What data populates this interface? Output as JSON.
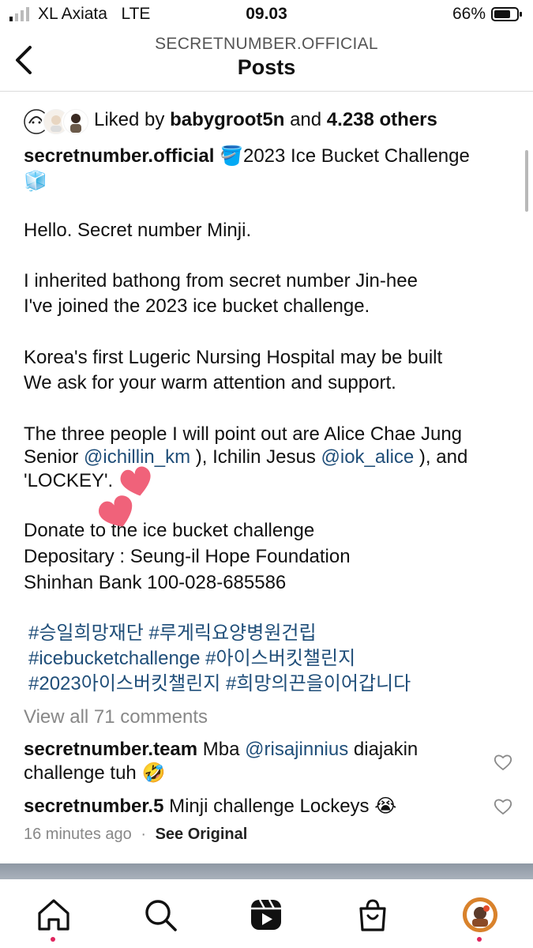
{
  "status_bar": {
    "carrier": "XL Axiata",
    "network": "LTE",
    "time": "09.03",
    "battery": "66%"
  },
  "header": {
    "account": "SECRETNUMBER.OFFICIAL",
    "title": "Posts"
  },
  "likes": {
    "prefix": "Liked by",
    "user": "babygroot5n",
    "and": "and",
    "others": "4.238 others"
  },
  "caption": {
    "username": "secretnumber.official",
    "title_emoji": "🪣",
    "title": "2023 Ice Bucket Challenge",
    "title_emoji_2": "🧊",
    "line_hello": "Hello. Secret number Minji.",
    "line_inherit_1": "I inherited bathong from secret number Jin-hee",
    "line_inherit_2": "I've joined the 2023 ice bucket challenge.",
    "line_korea_1": "Korea's first Lugeric Nursing Hospital may be built",
    "line_korea_2": "We ask for your warm attention and support.",
    "line_three_1": "The three people I will point out are Alice Chae Jung",
    "line_three_2a": "Senior ",
    "mention_1": "@ichillin_km",
    "line_three_2b": " ), Ichilin Jesus ",
    "mention_2": "@iok_alice",
    "line_three_2c": " ), and",
    "line_three_3": "'LOCKEY'.",
    "line_donate": "Donate to the ice bucket challenge",
    "line_depositary": "Depositary : Seung-il Hope Foundation",
    "line_bank": "Shinhan Bank 100-028-685586",
    "hashtags_1": "#승일희망재단 #루게릭요양병원건립",
    "hashtags_2": "#icebucketchallenge #아이스버킷챌린지",
    "hashtags_3": "#2023아이스버킷챌린지 #희망의끈을이어갑니다"
  },
  "view_all": "View all 71 comments",
  "comments": [
    {
      "username": "secretnumber.team",
      "text_a": " Mba ",
      "mention": "@risajinnius",
      "text_b": " diajakin",
      "text_c": "challenge tuh 🤣"
    },
    {
      "username": "secretnumber.5",
      "text_a": " Minji challenge Lockeys 😭"
    }
  ],
  "meta": {
    "time": "16 minutes ago",
    "separator": "·",
    "see_original": "See Original"
  },
  "tabs": [
    "home-icon",
    "search-icon",
    "reels-icon",
    "shop-icon",
    "profile-avatar"
  ],
  "colors": {
    "link": "#1f4e79",
    "muted": "#888888",
    "notification_dot": "#e0245e",
    "sticker_heart": "#f0627a"
  }
}
